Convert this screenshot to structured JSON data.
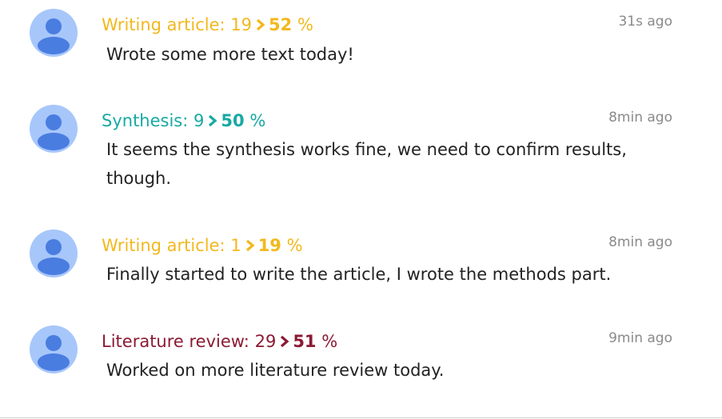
{
  "colors": {
    "writing": "#f2b81d",
    "synthesis": "#17a9a3",
    "literature": "#8b1a33",
    "time": "#8a8a8a",
    "text": "#222222",
    "avatar_bg": "#a7c7fb",
    "avatar_fg": "#4a7de0"
  },
  "entries": [
    {
      "task": "Writing article:",
      "old_value": "19",
      "new_value": "52",
      "unit": "%",
      "time": "31s ago",
      "message": "Wrote some more text today!",
      "icon": "user-avatar-icon"
    },
    {
      "task": "Synthesis:",
      "old_value": "9",
      "new_value": "50",
      "unit": "%",
      "time": "8min ago",
      "message": "It seems the synthesis works fine, we need to confirm results, though.",
      "icon": "user-avatar-icon"
    },
    {
      "task": "Writing article:",
      "old_value": "1",
      "new_value": "19",
      "unit": "%",
      "time": "8min ago",
      "message": "Finally started to write the article, I wrote the methods part.",
      "icon": "user-avatar-icon"
    },
    {
      "task": "Literature review:",
      "old_value": "29",
      "new_value": "51",
      "unit": "%",
      "time": "9min ago",
      "message": "Worked on more literature review today.",
      "icon": "user-avatar-icon"
    }
  ]
}
